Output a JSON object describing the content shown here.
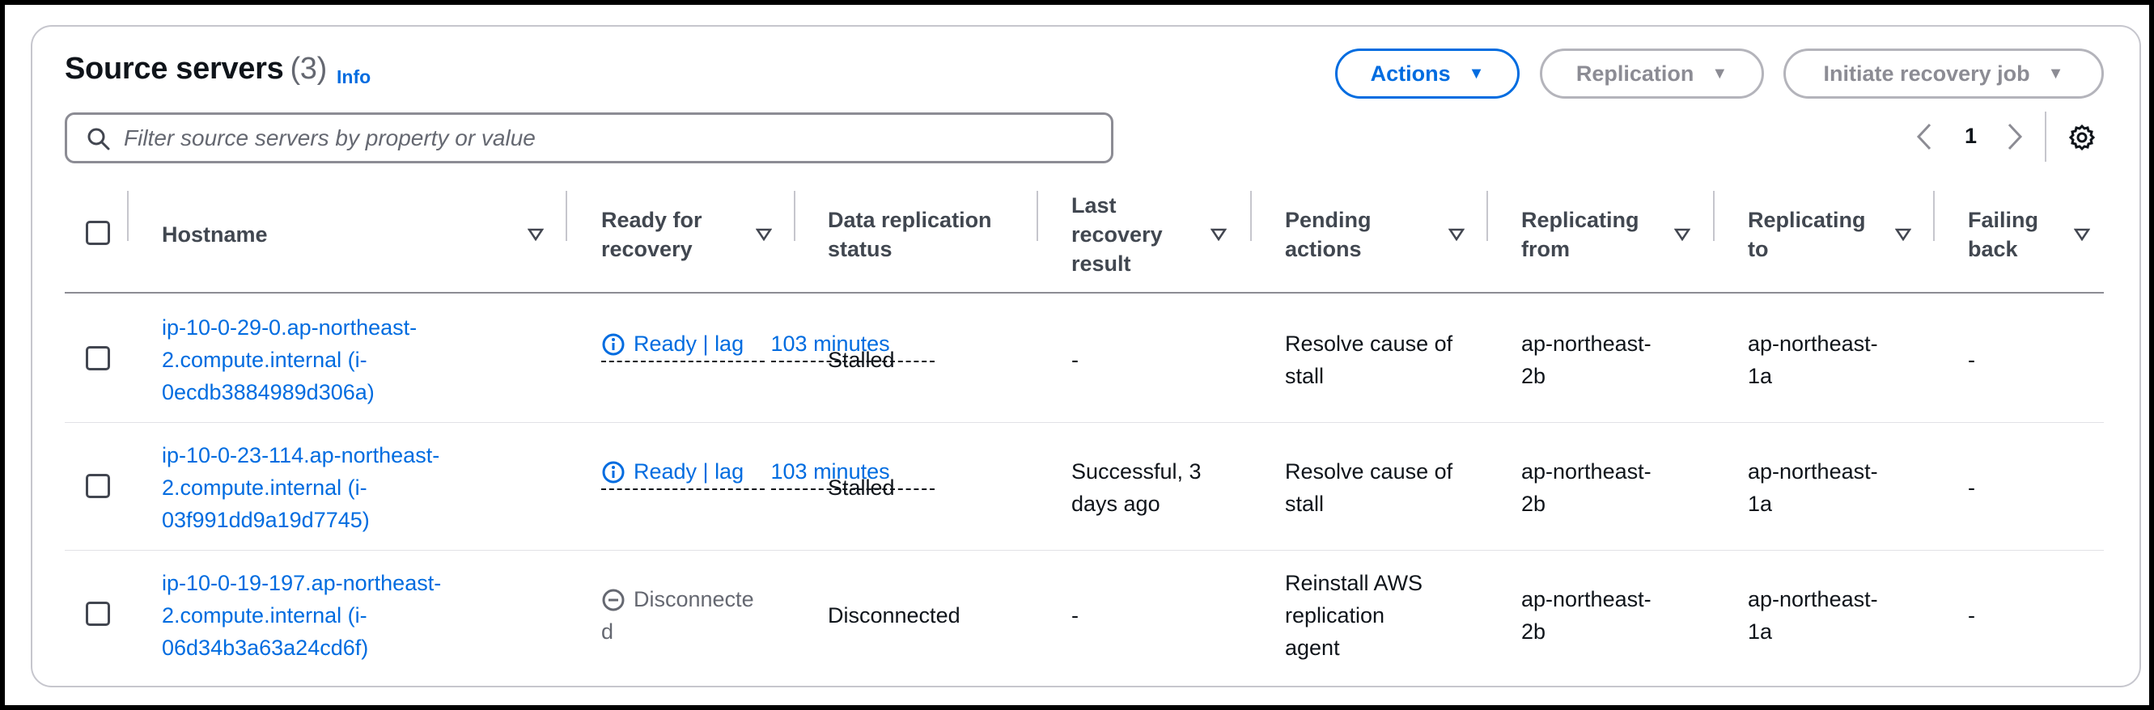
{
  "header": {
    "title": "Source servers",
    "count": "(3)",
    "info": "Info"
  },
  "toolbar": {
    "actions_label": "Actions",
    "replication_label": "Replication",
    "recovery_label": "Initiate recovery job"
  },
  "search": {
    "placeholder": "Filter source servers by property or value",
    "value": ""
  },
  "pagination": {
    "current_page": "1"
  },
  "table": {
    "columns": [
      {
        "line1": "Hostname",
        "line2": ""
      },
      {
        "line1": "Ready for",
        "line2": "recovery"
      },
      {
        "line1": "Data replication",
        "line2": "status"
      },
      {
        "line1": "Last",
        "line2": "recovery",
        "line3": "result"
      },
      {
        "line1": "Pending",
        "line2": "actions"
      },
      {
        "line1": "Replicating",
        "line2": "from"
      },
      {
        "line1": "Replicating",
        "line2": "to"
      },
      {
        "line1": "Failing",
        "line2": "back"
      }
    ],
    "rows": [
      {
        "hostname": [
          "ip-10-0-29-0.ap-northeast-",
          "2.compute.internal (i-",
          "0ecdb3884989d306a)"
        ],
        "ready": [
          "Ready | lag",
          "103 minutes"
        ],
        "status": "Stalled",
        "last_result": [
          "-"
        ],
        "pending": [
          "Resolve cause of",
          "stall"
        ],
        "from": [
          "ap-northeast-",
          "2b"
        ],
        "to": [
          "ap-northeast-",
          "1a"
        ],
        "failing_back": "-"
      },
      {
        "hostname": [
          "ip-10-0-23-114.ap-northeast-",
          "2.compute.internal (i-",
          "03f991dd9a19d7745)"
        ],
        "ready": [
          "Ready | lag",
          "103 minutes"
        ],
        "status": "Stalled",
        "last_result": [
          "Successful, 3",
          "days ago"
        ],
        "pending": [
          "Resolve cause of",
          "stall"
        ],
        "from": [
          "ap-northeast-",
          "2b"
        ],
        "to": [
          "ap-northeast-",
          "1a"
        ],
        "failing_back": "-"
      },
      {
        "hostname": [
          "ip-10-0-19-197.ap-northeast-",
          "2.compute.internal (i-",
          "06d34b3a63a24cd6f)"
        ],
        "ready": [
          "Disconnecte",
          "d"
        ],
        "status": "Disconnected",
        "last_result": [
          "-"
        ],
        "pending": [
          "Reinstall AWS",
          "replication",
          "agent"
        ],
        "from": [
          "ap-northeast-",
          "2b"
        ],
        "to": [
          "ap-northeast-",
          "1a"
        ],
        "failing_back": "-"
      }
    ]
  },
  "colors": {
    "link": "#006ce0",
    "text": "#0f141a",
    "muted": "#656871",
    "border": "#c6c6cd"
  },
  "icons": {
    "search": "search-icon",
    "info": "info-circle-icon",
    "disconnected": "minus-circle-icon",
    "settings": "gear-icon",
    "caret": "caret-down-icon",
    "sort": "sort-triangle-icon"
  }
}
